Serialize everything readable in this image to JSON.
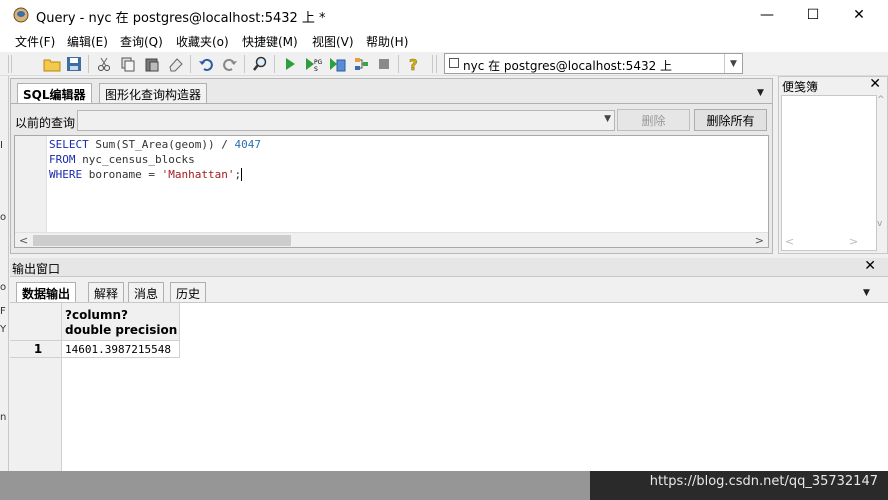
{
  "window": {
    "title": "Query - nyc 在  postgres@localhost:5432 上 *",
    "controls": {
      "minimize": "—",
      "maximize": "☐",
      "close": "✕"
    }
  },
  "menu": {
    "items": [
      {
        "label": "文件(F)"
      },
      {
        "label": "编辑(E)"
      },
      {
        "label": "查询(Q)"
      },
      {
        "label": "收藏夹(o)"
      },
      {
        "label": "快捷键(M)"
      },
      {
        "label": "视图(V)"
      },
      {
        "label": "帮助(H)"
      }
    ]
  },
  "toolbar": {
    "connection": "nyc 在  postgres@localhost:5432 上",
    "icons": [
      "open-icon",
      "save-icon",
      "cut-icon",
      "copy-icon",
      "paste-icon",
      "clear-icon",
      "undo-icon",
      "redo-icon",
      "find-icon",
      "execute-icon",
      "execute-pgscript-icon",
      "execute-to-file-icon",
      "explain-icon",
      "stop-icon",
      "help-icon"
    ]
  },
  "sql_panel": {
    "tabs": [
      {
        "label": "SQL编辑器",
        "active": true
      },
      {
        "label": "图形化查询构造器",
        "active": false
      }
    ],
    "previous_queries_label": "以前的查询",
    "delete_label": "删除",
    "delete_all_label": "删除所有",
    "code": {
      "line1": {
        "kw": "SELECT",
        "body": " Sum(ST_Area(geom)) / ",
        "num": "4047"
      },
      "line2": {
        "kw": "FROM",
        "body": " nyc_census_blocks"
      },
      "line3": {
        "kw": "WHERE",
        "body": " boroname = ",
        "str": "'Manhattan'",
        "tail": ";"
      }
    }
  },
  "bookmarks": {
    "title": "便笺簿",
    "close": "✕"
  },
  "output": {
    "title": "输出窗口",
    "close": "✕",
    "tabs": [
      {
        "label": "数据输出",
        "active": true
      },
      {
        "label": "解释",
        "active": false
      },
      {
        "label": "消息",
        "active": false
      },
      {
        "label": "历史",
        "active": false
      }
    ],
    "grid": {
      "columns": [
        {
          "name": "?column?",
          "type": "double precision"
        }
      ],
      "rows": [
        {
          "num": "1",
          "values": [
            "14601.3987215548"
          ]
        }
      ]
    }
  },
  "watermark": "https://blog.csdn.net/qq_35732147",
  "colors": {
    "keyword": "#1a2bb0",
    "string": "#a02020",
    "number": "#2b70b5"
  }
}
